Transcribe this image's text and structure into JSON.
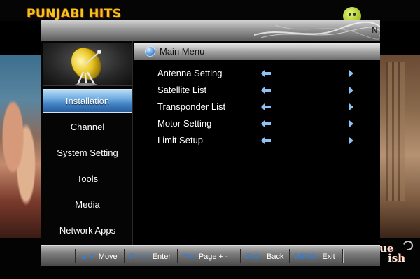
{
  "background": {
    "channel_name": "PUNJABI HITS",
    "watermark_line1": "ue",
    "watermark_line2": "ish"
  },
  "window": {
    "corner_text": "N"
  },
  "sidebar": {
    "items": [
      {
        "label": "Installation",
        "active": true
      },
      {
        "label": "Channel",
        "active": false
      },
      {
        "label": "System Setting",
        "active": false
      },
      {
        "label": "Tools",
        "active": false
      },
      {
        "label": "Media",
        "active": false
      },
      {
        "label": "Network Apps",
        "active": false
      }
    ]
  },
  "main": {
    "title": "Main Menu",
    "menu_items": [
      {
        "label": "Antenna Setting"
      },
      {
        "label": "Satellite List"
      },
      {
        "label": "Transponder List"
      },
      {
        "label": "Motor Setting"
      },
      {
        "label": "Limit Setup"
      }
    ]
  },
  "help_bar": {
    "move_key": "▲▼",
    "move_label": "Move",
    "enter_key": "Enter",
    "enter_label": "Enter",
    "page_key": "⏮⏭",
    "page_label": "Page + -",
    "exit_key": "Exit",
    "exit_label": "Back",
    "menu_key": "MENU",
    "menu_label": "Exit"
  },
  "colors": {
    "accent_blue": "#3c7cbf",
    "key_blue": "#2b7fe0",
    "channel_yellow": "#f2c51c"
  }
}
